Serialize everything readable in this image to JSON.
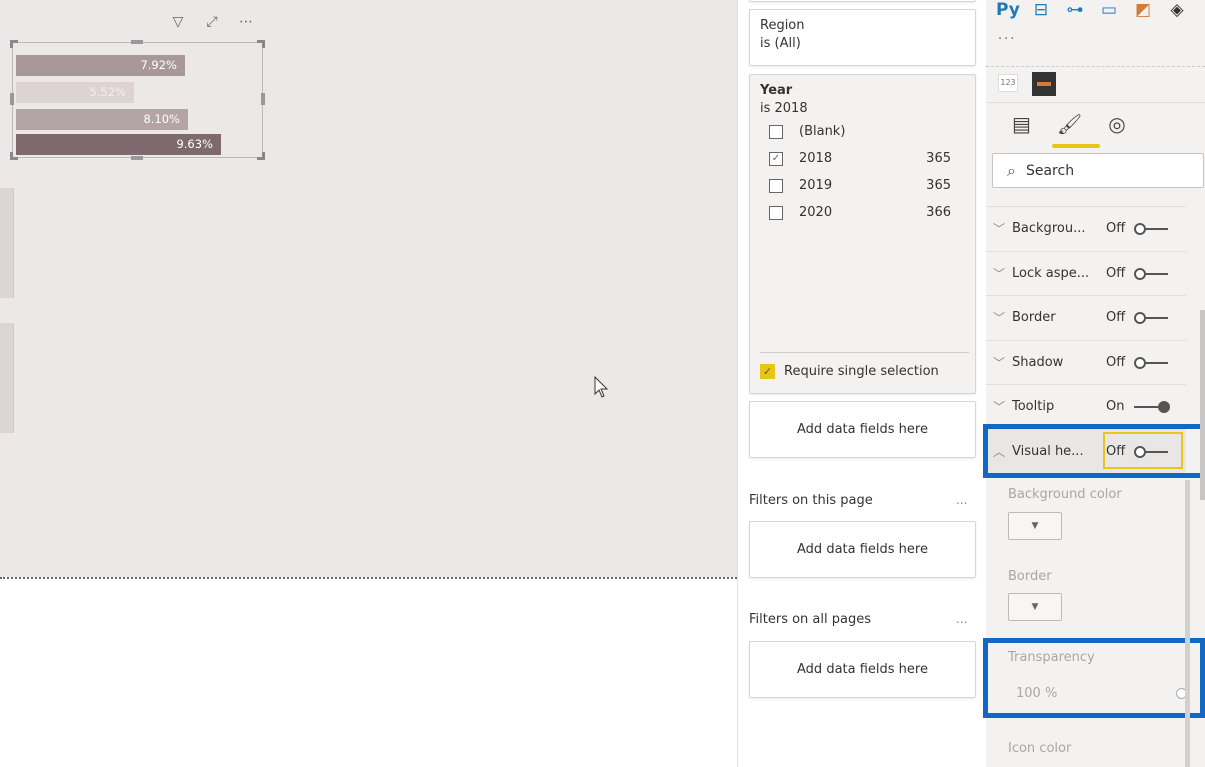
{
  "canvas": {
    "visual_header_icons": [
      "filter-icon",
      "focus-mode-icon",
      "more-options-icon"
    ],
    "visual_header_glyphs": [
      "▽",
      "⤢",
      "⋯"
    ],
    "bars": [
      {
        "label": "7.92%",
        "value": 7.92,
        "color": "#a8989b"
      },
      {
        "label": "5.52%",
        "value": 5.52,
        "color": "#ddd3d5"
      },
      {
        "label": "8.10%",
        "value": 8.1,
        "color": "#b2a4a7"
      },
      {
        "label": "9.63%",
        "value": 9.63,
        "color": "#7e6a6e"
      }
    ]
  },
  "filters": {
    "region": {
      "title": "Region",
      "state": "is (All)"
    },
    "year": {
      "title": "Year",
      "state": "is 2018",
      "options": [
        {
          "label": "(Blank)",
          "count": "",
          "checked": false
        },
        {
          "label": "2018",
          "count": "365",
          "checked": true
        },
        {
          "label": "2019",
          "count": "365",
          "checked": false
        },
        {
          "label": "2020",
          "count": "366",
          "checked": false
        }
      ],
      "require_single_selection": "Require single selection"
    },
    "add_fields": "Add data fields here",
    "this_page_label": "Filters on this page",
    "all_pages_label": "Filters on all pages",
    "more": "..."
  },
  "visualizations": {
    "icons": [
      {
        "name": "python-visual-icon",
        "glyph": "Py"
      },
      {
        "name": "key-influencers-icon",
        "glyph": "⊟"
      },
      {
        "name": "decomposition-tree-icon",
        "glyph": "⊶"
      },
      {
        "name": "qa-icon",
        "glyph": "▭"
      },
      {
        "name": "custom-visual-icon",
        "glyph": "◩"
      },
      {
        "name": "power-apps-icon",
        "glyph": "◈"
      }
    ],
    "more": "...",
    "custom": [
      "123",
      "▬"
    ],
    "tabs": [
      {
        "name": "fields-tab",
        "glyph": "▤"
      },
      {
        "name": "format-tab",
        "glyph": "🖌"
      },
      {
        "name": "analytics-tab",
        "glyph": "◎"
      }
    ],
    "search_placeholder": "Search",
    "properties": [
      {
        "label": "Backgrou...",
        "state": "Off",
        "on": false,
        "expanded": false
      },
      {
        "label": "Lock aspe...",
        "state": "Off",
        "on": false,
        "expanded": false
      },
      {
        "label": "Border",
        "state": "Off",
        "on": false,
        "expanded": false
      },
      {
        "label": "Shadow",
        "state": "Off",
        "on": false,
        "expanded": false
      },
      {
        "label": "Tooltip",
        "state": "On",
        "on": true,
        "expanded": false
      },
      {
        "label": "Visual he...",
        "state": "Off",
        "on": false,
        "expanded": true
      }
    ],
    "visual_header_settings": {
      "background_color": "Background color",
      "border": "Border",
      "transparency": "Transparency",
      "transparency_value": "100  %",
      "icon_color": "Icon color"
    }
  }
}
